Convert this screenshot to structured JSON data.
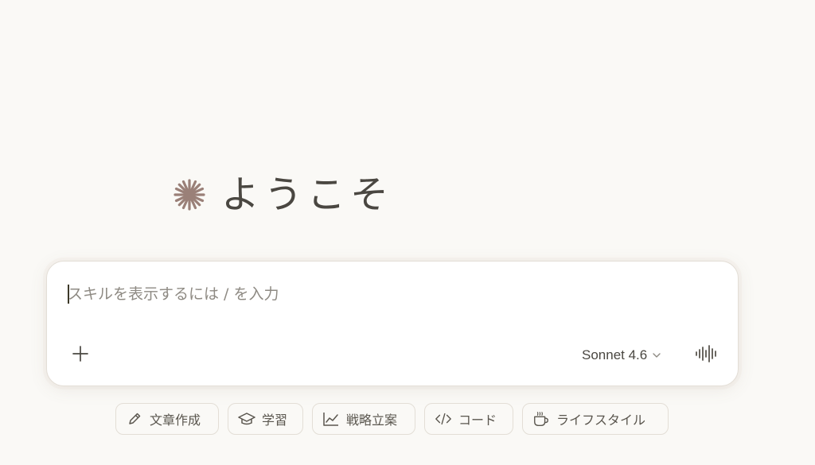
{
  "greeting": {
    "title": "ようこそ",
    "logo_icon": "starburst-icon",
    "logo_color": "#9a8078"
  },
  "composer": {
    "placeholder": "スキルを表示するには / を入力",
    "add_icon": "plus-icon",
    "model": {
      "label": "Sonnet 4.6",
      "icon": "chevron-down-icon"
    },
    "voice_icon": "voice-waveform-icon"
  },
  "chips": [
    {
      "label": "文章作成",
      "icon": "pencil-icon"
    },
    {
      "label": "学習",
      "icon": "graduation-cap-icon"
    },
    {
      "label": "戦略立案",
      "icon": "line-chart-icon"
    },
    {
      "label": "コード",
      "icon": "code-icon"
    },
    {
      "label": "ライフスタイル",
      "icon": "coffee-cup-icon"
    }
  ]
}
